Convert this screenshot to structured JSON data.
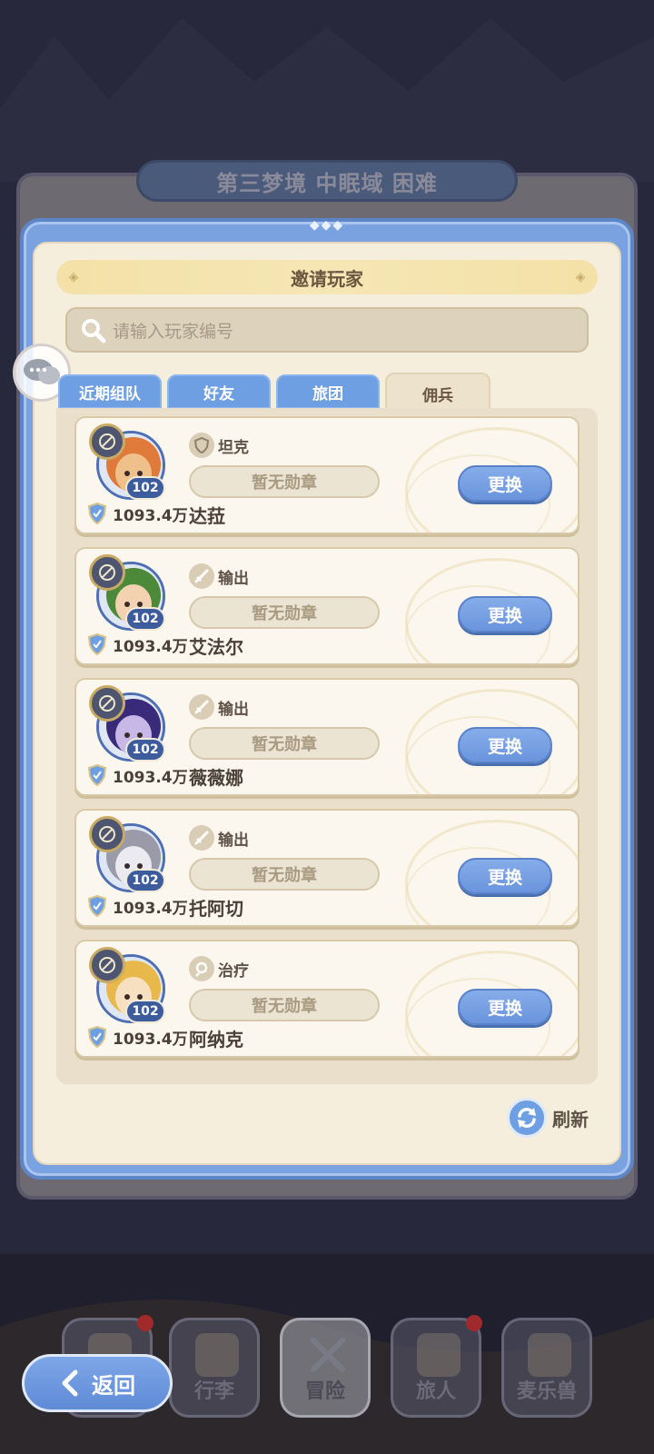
{
  "stage_title": "第三梦境 中眠域 困难",
  "dialog": {
    "title": "邀请玩家",
    "search_placeholder": "请输入玩家编号",
    "tabs": [
      {
        "label": "近期组队",
        "active": false
      },
      {
        "label": "好友",
        "active": false
      },
      {
        "label": "旅团",
        "active": false
      },
      {
        "label": "佣兵",
        "active": true
      }
    ],
    "mercenaries": [
      {
        "name": "达菈",
        "role": "坦克",
        "role_icon": "shield-icon",
        "level": "102",
        "power": "1093.4万",
        "medal": "暂无勋章",
        "swap_label": "更换",
        "avatar_color": "#f0c08a",
        "hair_color": "#e07a3a"
      },
      {
        "name": "艾法尔",
        "role": "输出",
        "role_icon": "sword-icon",
        "level": "102",
        "power": "1093.4万",
        "medal": "暂无勋章",
        "swap_label": "更换",
        "avatar_color": "#f2d2b0",
        "hair_color": "#4c8a3a"
      },
      {
        "name": "薇薇娜",
        "role": "输出",
        "role_icon": "sword-icon",
        "level": "102",
        "power": "1093.4万",
        "medal": "暂无勋章",
        "swap_label": "更换",
        "avatar_color": "#c8b8e8",
        "hair_color": "#3a2a7a"
      },
      {
        "name": "托阿切",
        "role": "输出",
        "role_icon": "sword-icon",
        "level": "102",
        "power": "1093.4万",
        "medal": "暂无勋章",
        "swap_label": "更换",
        "avatar_color": "#eaeaf0",
        "hair_color": "#9a9aa8"
      },
      {
        "name": "阿纳克",
        "role": "治疗",
        "role_icon": "heal-icon",
        "level": "102",
        "power": "1093.4万",
        "medal": "暂无勋章",
        "swap_label": "更换",
        "avatar_color": "#f6e0c0",
        "hair_color": "#e8b84a"
      }
    ],
    "refresh_label": "刷新"
  },
  "bottom_nav": [
    {
      "label": "",
      "icon": "castle-icon",
      "badge": true
    },
    {
      "label": "行李",
      "icon": "backpack-icon",
      "badge": false
    },
    {
      "label": "冒险",
      "icon": "crossed-swords-icon",
      "badge": false,
      "active": true
    },
    {
      "label": "旅人",
      "icon": "character-icon",
      "badge": true
    },
    {
      "label": "麦乐兽",
      "icon": "pet-icon",
      "badge": false
    }
  ],
  "back_label": "返回",
  "colors": {
    "accent_blue": "#6f9fe3",
    "panel_cream": "#f5eedd",
    "card_bg": "#fbf7ee",
    "text_brown": "#4a4038"
  }
}
